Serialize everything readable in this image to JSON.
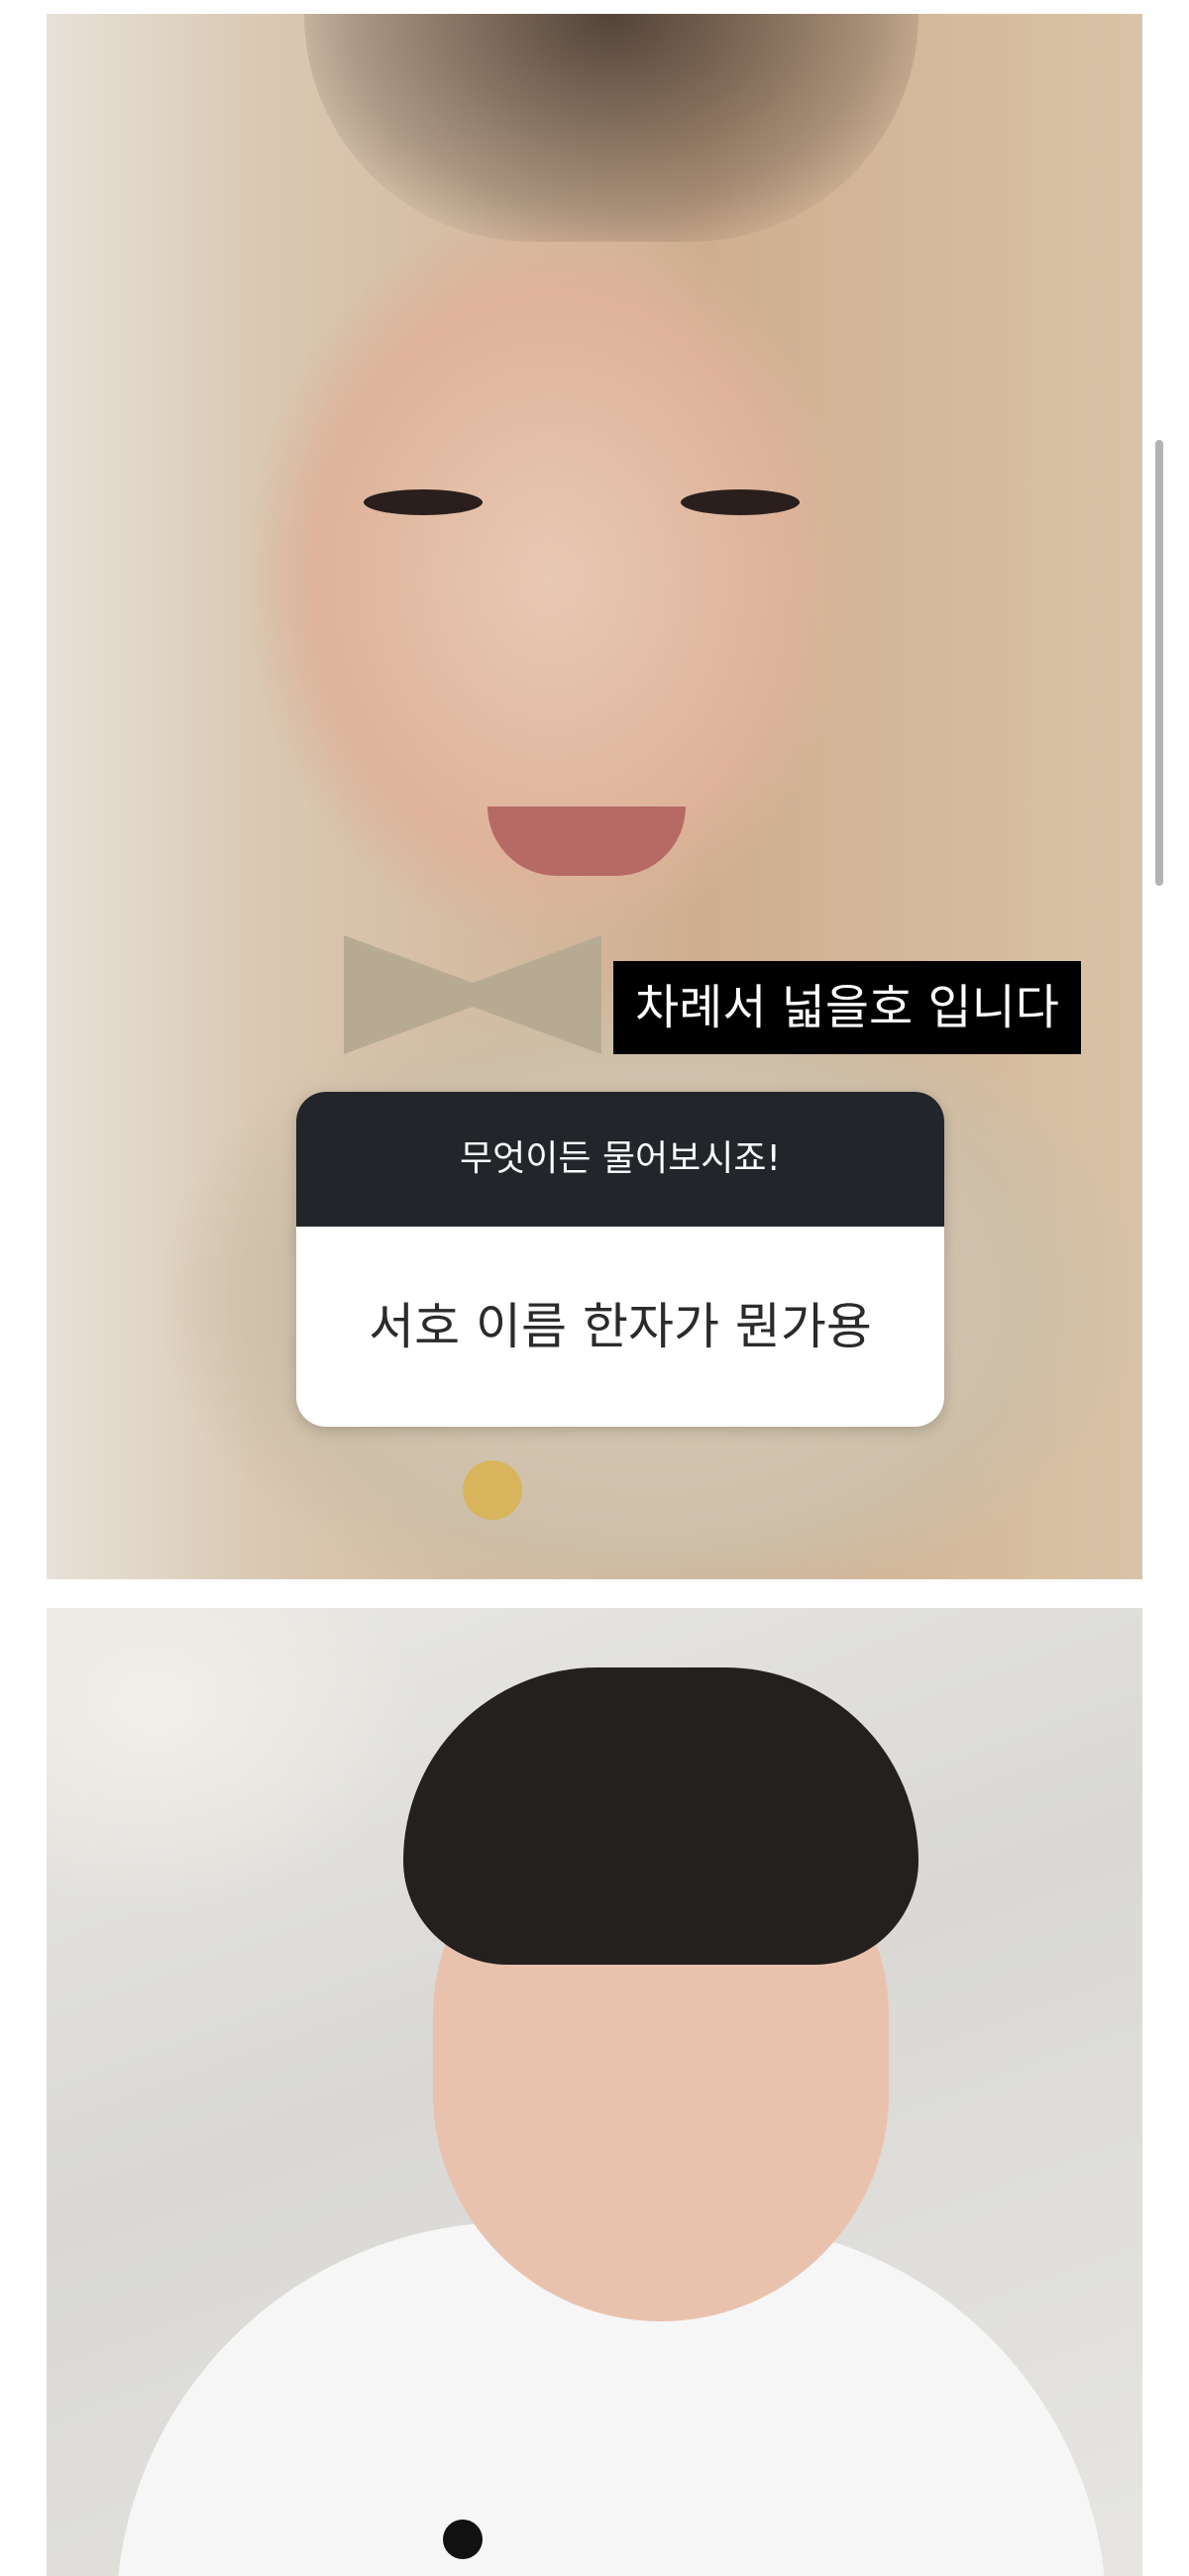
{
  "story_image": {
    "caption": "차례서  넓을호  입니다",
    "question_box": {
      "header": "무엇이든 물어보시죠!",
      "question": "서호 이름 한자가 뭔가용"
    }
  },
  "colors": {
    "caption_bg": "#000000",
    "question_header_bg": "#22262b",
    "question_body_bg": "#ffffff"
  }
}
